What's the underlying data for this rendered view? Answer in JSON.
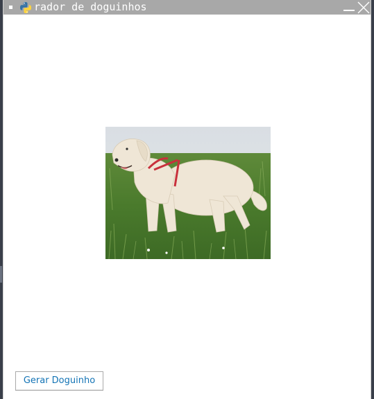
{
  "window": {
    "title": "rador de doguinhos",
    "icons": {
      "menu": "window-menu-icon",
      "app": "python-logo-icon",
      "minimize": "minimize-icon",
      "close": "close-icon"
    }
  },
  "main": {
    "image": {
      "subject": "dog-photo"
    },
    "button": {
      "label": "Gerar Doguinho"
    }
  },
  "colors": {
    "titlebar": "#a8a8a8",
    "button_text": "#1273b5",
    "python_blue": "#3572a5",
    "python_yellow": "#ffd43b"
  }
}
